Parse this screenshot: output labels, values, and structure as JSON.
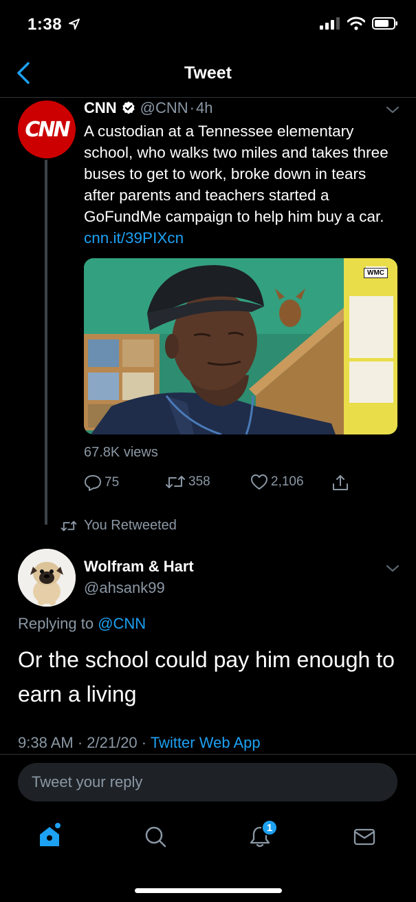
{
  "status_bar": {
    "time": "1:38"
  },
  "nav": {
    "title": "Tweet"
  },
  "tweet": {
    "author_name": "CNN",
    "handle": "@CNN",
    "time_sep": "·",
    "time": "4h",
    "avatar_text": "CNN",
    "text": "A custodian at a Tennessee elementary school, who walks two miles and takes three buses to get to work, broke down in tears after parents and teachers started a GoFundMe campaign to help him buy a car.",
    "link": "cnn.it/39PIXcn",
    "media_badge": "WMC",
    "views": "67.8K views",
    "replies": "75",
    "retweets": "358",
    "likes": "2,106"
  },
  "retweet_notice": "You Retweeted",
  "reply": {
    "author_name": "Wolfram & Hart",
    "handle": "@ahsank99",
    "replying_prefix": "Replying to",
    "replying_to": "@CNN",
    "text": "Or the school could pay him enough to earn a living",
    "timestamp": "9:38 AM · 2/21/20 ·",
    "source": "Twitter Web App"
  },
  "compose": {
    "placeholder": "Tweet your reply"
  },
  "tab_bar": {
    "notifications_badge": "1"
  },
  "colors": {
    "accent": "#1da1f2",
    "background": "#000000",
    "secondary_text": "#8b98a5",
    "cnn_red": "#cc0000"
  },
  "icons": [
    "back-chevron-icon",
    "verified-icon",
    "chevron-down-icon",
    "reply-icon",
    "retweet-icon",
    "like-icon",
    "share-icon",
    "home-icon",
    "search-icon",
    "notifications-icon",
    "messages-icon"
  ]
}
